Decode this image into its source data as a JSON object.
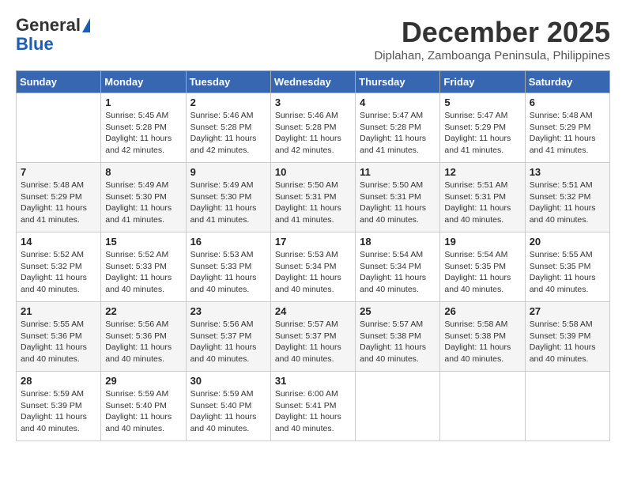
{
  "header": {
    "logo_line1": "General",
    "logo_line2": "Blue",
    "month_title": "December 2025",
    "subtitle": "Diplahan, Zamboanga Peninsula, Philippines"
  },
  "calendar": {
    "days_of_week": [
      "Sunday",
      "Monday",
      "Tuesday",
      "Wednesday",
      "Thursday",
      "Friday",
      "Saturday"
    ],
    "weeks": [
      [
        {
          "day": "",
          "info": ""
        },
        {
          "day": "1",
          "info": "Sunrise: 5:45 AM\nSunset: 5:28 PM\nDaylight: 11 hours\nand 42 minutes."
        },
        {
          "day": "2",
          "info": "Sunrise: 5:46 AM\nSunset: 5:28 PM\nDaylight: 11 hours\nand 42 minutes."
        },
        {
          "day": "3",
          "info": "Sunrise: 5:46 AM\nSunset: 5:28 PM\nDaylight: 11 hours\nand 42 minutes."
        },
        {
          "day": "4",
          "info": "Sunrise: 5:47 AM\nSunset: 5:28 PM\nDaylight: 11 hours\nand 41 minutes."
        },
        {
          "day": "5",
          "info": "Sunrise: 5:47 AM\nSunset: 5:29 PM\nDaylight: 11 hours\nand 41 minutes."
        },
        {
          "day": "6",
          "info": "Sunrise: 5:48 AM\nSunset: 5:29 PM\nDaylight: 11 hours\nand 41 minutes."
        }
      ],
      [
        {
          "day": "7",
          "info": "Sunrise: 5:48 AM\nSunset: 5:29 PM\nDaylight: 11 hours\nand 41 minutes."
        },
        {
          "day": "8",
          "info": "Sunrise: 5:49 AM\nSunset: 5:30 PM\nDaylight: 11 hours\nand 41 minutes."
        },
        {
          "day": "9",
          "info": "Sunrise: 5:49 AM\nSunset: 5:30 PM\nDaylight: 11 hours\nand 41 minutes."
        },
        {
          "day": "10",
          "info": "Sunrise: 5:50 AM\nSunset: 5:31 PM\nDaylight: 11 hours\nand 41 minutes."
        },
        {
          "day": "11",
          "info": "Sunrise: 5:50 AM\nSunset: 5:31 PM\nDaylight: 11 hours\nand 40 minutes."
        },
        {
          "day": "12",
          "info": "Sunrise: 5:51 AM\nSunset: 5:31 PM\nDaylight: 11 hours\nand 40 minutes."
        },
        {
          "day": "13",
          "info": "Sunrise: 5:51 AM\nSunset: 5:32 PM\nDaylight: 11 hours\nand 40 minutes."
        }
      ],
      [
        {
          "day": "14",
          "info": "Sunrise: 5:52 AM\nSunset: 5:32 PM\nDaylight: 11 hours\nand 40 minutes."
        },
        {
          "day": "15",
          "info": "Sunrise: 5:52 AM\nSunset: 5:33 PM\nDaylight: 11 hours\nand 40 minutes."
        },
        {
          "day": "16",
          "info": "Sunrise: 5:53 AM\nSunset: 5:33 PM\nDaylight: 11 hours\nand 40 minutes."
        },
        {
          "day": "17",
          "info": "Sunrise: 5:53 AM\nSunset: 5:34 PM\nDaylight: 11 hours\nand 40 minutes."
        },
        {
          "day": "18",
          "info": "Sunrise: 5:54 AM\nSunset: 5:34 PM\nDaylight: 11 hours\nand 40 minutes."
        },
        {
          "day": "19",
          "info": "Sunrise: 5:54 AM\nSunset: 5:35 PM\nDaylight: 11 hours\nand 40 minutes."
        },
        {
          "day": "20",
          "info": "Sunrise: 5:55 AM\nSunset: 5:35 PM\nDaylight: 11 hours\nand 40 minutes."
        }
      ],
      [
        {
          "day": "21",
          "info": "Sunrise: 5:55 AM\nSunset: 5:36 PM\nDaylight: 11 hours\nand 40 minutes."
        },
        {
          "day": "22",
          "info": "Sunrise: 5:56 AM\nSunset: 5:36 PM\nDaylight: 11 hours\nand 40 minutes."
        },
        {
          "day": "23",
          "info": "Sunrise: 5:56 AM\nSunset: 5:37 PM\nDaylight: 11 hours\nand 40 minutes."
        },
        {
          "day": "24",
          "info": "Sunrise: 5:57 AM\nSunset: 5:37 PM\nDaylight: 11 hours\nand 40 minutes."
        },
        {
          "day": "25",
          "info": "Sunrise: 5:57 AM\nSunset: 5:38 PM\nDaylight: 11 hours\nand 40 minutes."
        },
        {
          "day": "26",
          "info": "Sunrise: 5:58 AM\nSunset: 5:38 PM\nDaylight: 11 hours\nand 40 minutes."
        },
        {
          "day": "27",
          "info": "Sunrise: 5:58 AM\nSunset: 5:39 PM\nDaylight: 11 hours\nand 40 minutes."
        }
      ],
      [
        {
          "day": "28",
          "info": "Sunrise: 5:59 AM\nSunset: 5:39 PM\nDaylight: 11 hours\nand 40 minutes."
        },
        {
          "day": "29",
          "info": "Sunrise: 5:59 AM\nSunset: 5:40 PM\nDaylight: 11 hours\nand 40 minutes."
        },
        {
          "day": "30",
          "info": "Sunrise: 5:59 AM\nSunset: 5:40 PM\nDaylight: 11 hours\nand 40 minutes."
        },
        {
          "day": "31",
          "info": "Sunrise: 6:00 AM\nSunset: 5:41 PM\nDaylight: 11 hours\nand 40 minutes."
        },
        {
          "day": "",
          "info": ""
        },
        {
          "day": "",
          "info": ""
        },
        {
          "day": "",
          "info": ""
        }
      ]
    ]
  }
}
